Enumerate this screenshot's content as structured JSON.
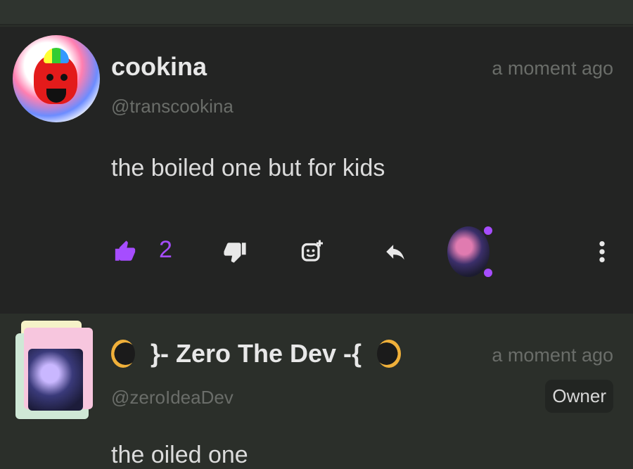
{
  "posts": [
    {
      "author_name": "cookina",
      "handle": "@transcookina",
      "time": "a moment ago",
      "text": "the boiled one but for kids",
      "likes": "2",
      "icons": {
        "like": "thumbs-up-icon",
        "dislike": "thumbs-down-icon",
        "react": "add-reaction-icon",
        "reply": "reply-icon",
        "more": "more-vertical-icon"
      }
    },
    {
      "author_name": "}- Zero The Dev -{",
      "handle": "@zeroIdeaDev",
      "time": "a moment ago",
      "badge": "Owner",
      "text": "the oiled one"
    }
  ],
  "colors": {
    "accent": "#a64dff",
    "background": "#232423",
    "muted_text": "#6a6d69"
  }
}
